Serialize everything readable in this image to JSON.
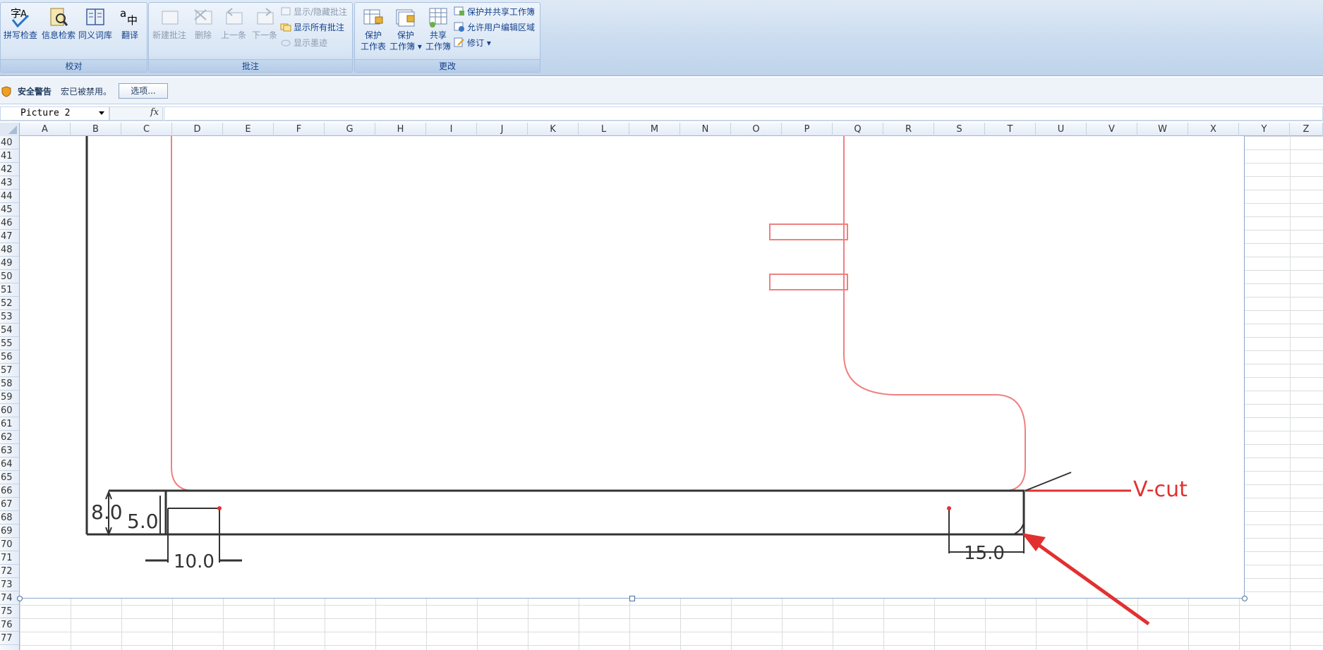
{
  "ribbon": {
    "groups": [
      {
        "label": "校对",
        "buttons": [
          {
            "label": "拼写检查",
            "icon": "spell-check-icon"
          },
          {
            "label": "信息检索",
            "icon": "research-icon"
          },
          {
            "label": "同义词库",
            "icon": "thesaurus-icon"
          },
          {
            "label": "翻译",
            "icon": "translate-icon"
          }
        ]
      },
      {
        "label": "批注",
        "buttons": [
          {
            "label": "新建批注",
            "icon": "new-comment-icon"
          },
          {
            "label": "删除",
            "icon": "delete-comment-icon"
          },
          {
            "label": "上一条",
            "icon": "previous-comment-icon"
          },
          {
            "label": "下一条",
            "icon": "next-comment-icon"
          }
        ],
        "small": [
          {
            "label": "显示/隐藏批注"
          },
          {
            "label": "显示所有批注"
          },
          {
            "label": "显示墨迹"
          }
        ]
      },
      {
        "label": "更改",
        "buttons": [
          {
            "label1": "保护",
            "label2": "工作表"
          },
          {
            "label1": "保护",
            "label2": "工作簿 ▾"
          },
          {
            "label1": "共享",
            "label2": "工作簿"
          }
        ],
        "small": [
          {
            "label": "保护并共享工作簿"
          },
          {
            "label": "允许用户编辑区域"
          },
          {
            "label": "修订 ▾"
          }
        ]
      }
    ]
  },
  "security_bar": {
    "title": "安全警告",
    "message": "宏已被禁用。",
    "options_button": "选项..."
  },
  "formula_bar": {
    "name_box": "Picture 2",
    "fx": "fx"
  },
  "grid": {
    "columns": [
      "A",
      "B",
      "C",
      "D",
      "E",
      "F",
      "G",
      "H",
      "I",
      "J",
      "K",
      "L",
      "M",
      "N",
      "O",
      "P",
      "Q",
      "R",
      "S",
      "T",
      "U",
      "V",
      "W",
      "X",
      "Y",
      "Z"
    ],
    "rows": [
      "40",
      "41",
      "42",
      "43",
      "44",
      "45",
      "46",
      "47",
      "48",
      "49",
      "50",
      "51",
      "52",
      "53",
      "54",
      "55",
      "56",
      "57",
      "58",
      "59",
      "60",
      "61",
      "62",
      "63",
      "64",
      "65",
      "66",
      "67",
      "68",
      "69",
      "70",
      "71",
      "72",
      "73",
      "74",
      "75",
      "76",
      "77"
    ]
  },
  "drawing": {
    "dim_8": "8.0",
    "dim_5": "5.0",
    "dim_10": "10.0",
    "dim_15": "15.0",
    "vcut_label": "V-cut",
    "colors": {
      "black": "#333333",
      "pink": "#f08080",
      "red": "#e23030"
    }
  }
}
